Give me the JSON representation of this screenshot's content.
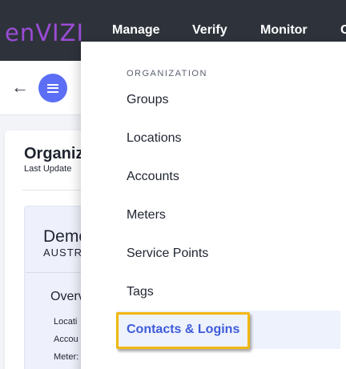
{
  "app": {
    "logo": "enVIZI"
  },
  "nav": {
    "items": [
      "Manage",
      "Verify",
      "Monitor",
      "C"
    ]
  },
  "toolbar": {
    "back_icon": "←"
  },
  "card": {
    "title": "Organiz",
    "last_updated": "Last Update"
  },
  "org": {
    "name": "Demo",
    "country": "AUSTR",
    "overview": "Overv",
    "stats": [
      "Locati",
      "Accou",
      "Meter:"
    ]
  },
  "menu": {
    "section_label": "ORGANIZATION",
    "items": [
      "Groups",
      "Locations",
      "Accounts",
      "Meters",
      "Service Points",
      "Tags",
      "Contacts & Logins"
    ],
    "active_index": 6
  },
  "colors": {
    "topbar": "#2e333b",
    "brand": "#9b4cd6",
    "accent": "#5b6ef5",
    "active_text": "#3d5bd9",
    "highlight": "#f1b712"
  }
}
